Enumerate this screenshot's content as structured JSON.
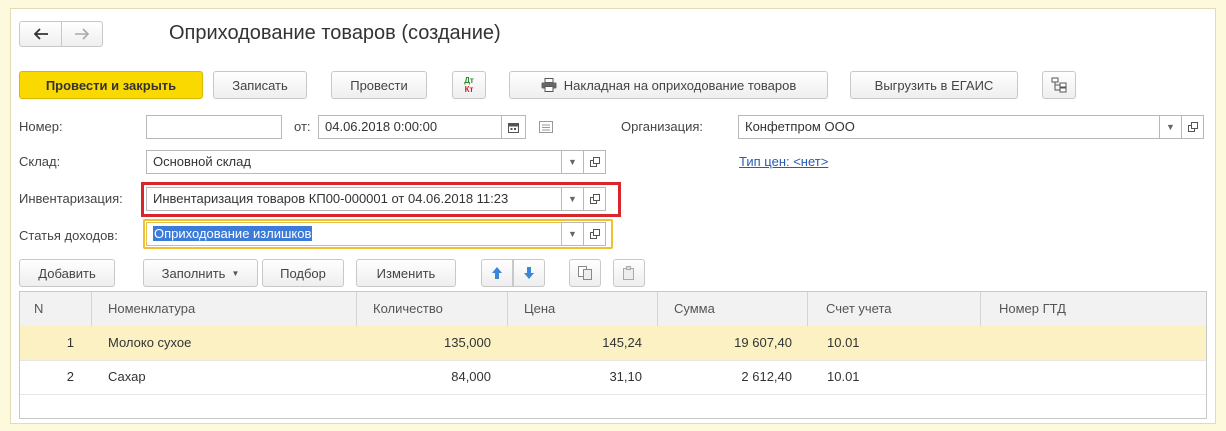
{
  "nav": {
    "back_icon": "arrow-left-icon",
    "forward_icon": "arrow-right-icon"
  },
  "title": "Оприходование товаров (создание)",
  "toolbar": {
    "post_close": "Провести и закрыть",
    "save": "Записать",
    "post": "Провести",
    "dtkt_top": "Дт",
    "dtkt_bottom": "Кт",
    "print_invoice": "Накладная на оприходование товаров",
    "export_egais": "Выгрузить в ЕГАИС"
  },
  "form": {
    "number_label": "Номер:",
    "number_value": "",
    "date_label": "от:",
    "date_value": "04.06.2018  0:00:00",
    "org_label": "Организация:",
    "org_value": "Конфетпром ООО",
    "warehouse_label": "Склад:",
    "warehouse_value": "Основной склад",
    "price_type_link": "Тип цен: <нет>",
    "inventory_label": "Инвентаризация:",
    "inventory_value": "Инвентаризация товаров КП00-000001 от 04.06.2018 11:23",
    "income_label": "Статья доходов:",
    "income_value": "Оприходование излишков"
  },
  "table_toolbar": {
    "add": "Добавить",
    "fill": "Заполнить",
    "pick": "Подбор",
    "change": "Изменить"
  },
  "table": {
    "columns": [
      "N",
      "Номенклатура",
      "Количество",
      "Цена",
      "Сумма",
      "Счет учета",
      "Номер ГТД"
    ],
    "rows": [
      {
        "n": "1",
        "item": "Молоко сухое",
        "qty": "135,000",
        "price": "145,24",
        "sum": "19 607,40",
        "account": "10.01",
        "gtd": ""
      },
      {
        "n": "2",
        "item": "Сахар",
        "qty": "84,000",
        "price": "31,10",
        "sum": "2 612,40",
        "account": "10.01",
        "gtd": ""
      }
    ]
  },
  "colors": {
    "primary_button": "#fad900",
    "highlight_red": "#d9262b",
    "highlight_yellow": "#f0c030",
    "selection_blue": "#3d7bd8",
    "selected_row": "#fbf1c3",
    "link": "#245eb0",
    "arrow_blue": "#3a86d8"
  }
}
